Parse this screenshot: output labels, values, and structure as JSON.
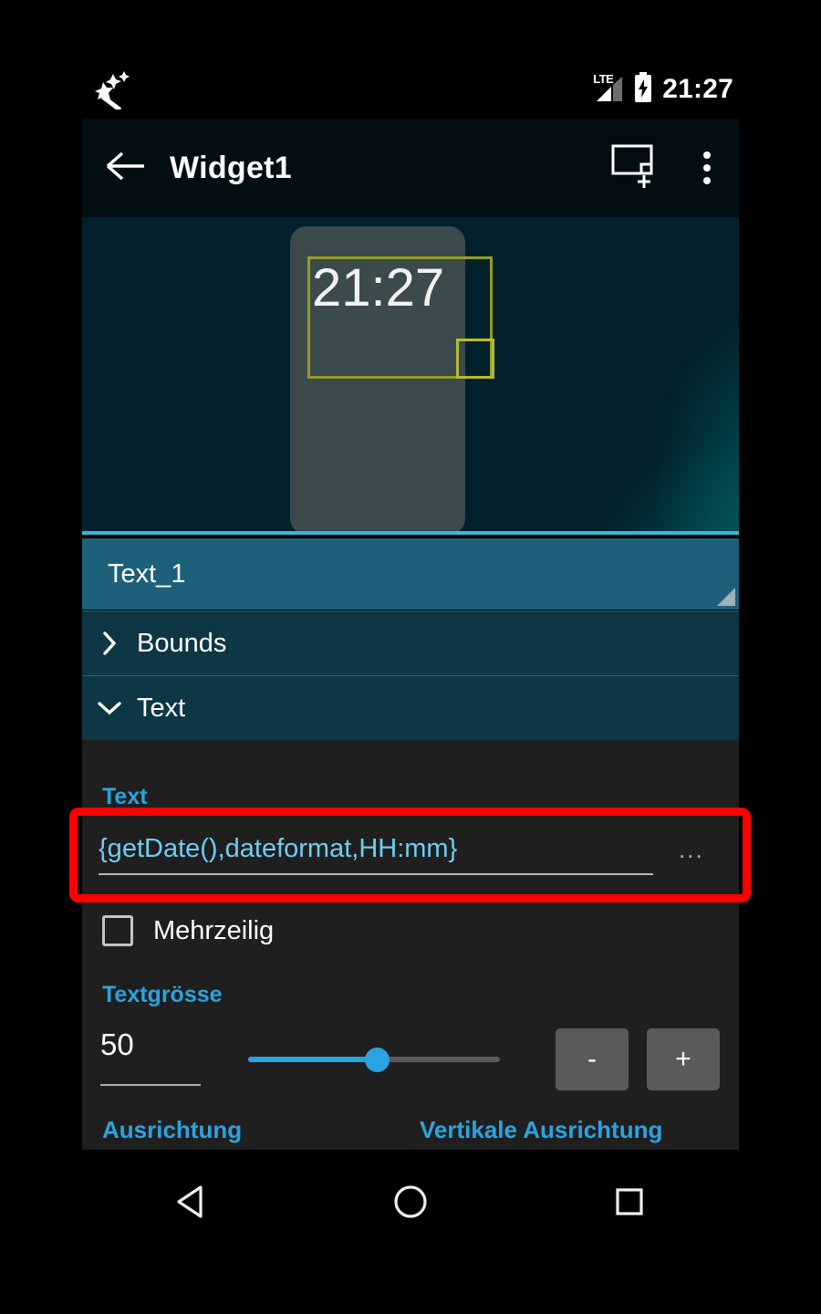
{
  "statusbar": {
    "notification_icon": "magic-wand-icon",
    "network_label": "LTE",
    "battery_icon": "battery-charging-icon",
    "time": "21:27"
  },
  "appbar": {
    "back_icon": "arrow-left-icon",
    "title": "Widget1",
    "add_widget_icon": "add-widget-icon",
    "overflow_icon": "more-vertical-icon"
  },
  "preview": {
    "widget_time": "21:27",
    "selection_color": "#9a9b22",
    "card_color": "#3b4a4d",
    "background_color": "#02212b"
  },
  "spinner": {
    "selected_layer": "Text_1",
    "bar_color": "#1d6079"
  },
  "sections": [
    {
      "label": "Bounds",
      "expanded": false,
      "chevron": "chevron-right-icon"
    },
    {
      "label": "Text",
      "expanded": true,
      "chevron": "chevron-down-icon"
    }
  ],
  "text_section": {
    "text_label": "Text",
    "text_value": "{getDate(),dateformat,HH:mm}",
    "more_button": "...",
    "multiline_label": "Mehrzeilig",
    "multiline_checked": false,
    "size_label": "Textgrösse",
    "size_value": "50",
    "slider_percent": 51,
    "minus_label": "-",
    "plus_label": "+",
    "align_label": "Ausrichtung",
    "valign_label": "Vertikale Ausrichtung",
    "accent_color": "#2aa4e0",
    "value_color": "#6fcdf0"
  },
  "annotation": {
    "color": "#fe0000",
    "target": "text-value-field"
  },
  "navbar": {
    "back_icon": "nav-back-triangle-icon",
    "home_icon": "nav-home-circle-icon",
    "recents_icon": "nav-recents-square-icon"
  }
}
